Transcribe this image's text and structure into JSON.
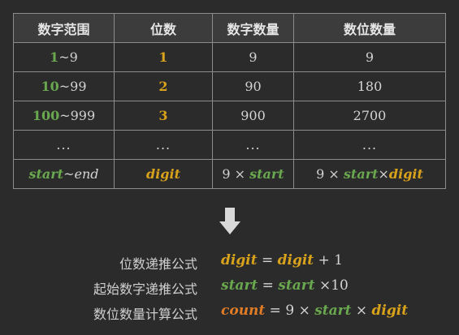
{
  "table": {
    "headers": [
      "数字范围",
      "位数",
      "数字数量",
      "数位数量"
    ],
    "rows": [
      {
        "range_start": "1",
        "range_sep": "~",
        "range_end": "9",
        "digit": "1",
        "count": "9",
        "total": "9"
      },
      {
        "range_start": "10",
        "range_sep": "~",
        "range_end": "99",
        "digit": "2",
        "count": "90",
        "total": "180"
      },
      {
        "range_start": "100",
        "range_sep": "~",
        "range_end": "999",
        "digit": "3",
        "count": "900",
        "total": "2700"
      },
      {
        "ellipsis": "..."
      }
    ],
    "general_row": {
      "range_start": "start",
      "range_sep": "~",
      "range_end": "end",
      "digit": "digit",
      "count_coef": "9",
      "count_times": "×",
      "count_var": "start",
      "total_coef": "9",
      "total_times1": "×",
      "total_var1": "start",
      "total_times2": "×",
      "total_var2": "digit"
    }
  },
  "arrow_icon": "down-arrow-icon",
  "formulas": [
    {
      "label": "位数递推公式",
      "lhs": "digit",
      "eq": "=",
      "rhs_var": "digit",
      "op": "+",
      "rhs_num": "1"
    },
    {
      "label": "起始数字递推公式",
      "lhs": "start",
      "eq": "=",
      "rhs_var": "start",
      "op": "×",
      "rhs_num": "10"
    },
    {
      "label": "数位数量计算公式",
      "lhs": "count",
      "eq": "=",
      "coef": "9",
      "times1": "×",
      "var1": "start",
      "times2": "×",
      "var2": "digit"
    }
  ],
  "colors": {
    "background": "#2b2b2b",
    "green": "#6aa84f",
    "gold": "#d9a21b",
    "orange": "#e07b26",
    "border": "#8c8c8c"
  }
}
